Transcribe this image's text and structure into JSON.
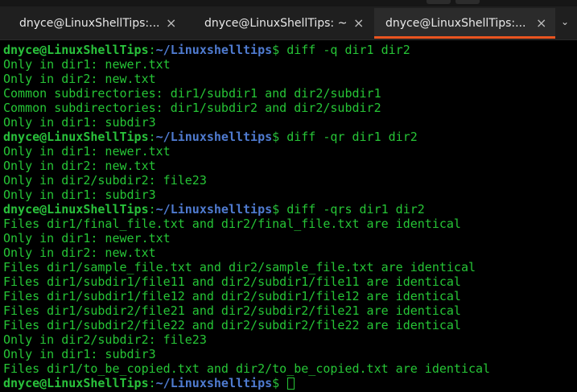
{
  "tabs": [
    {
      "label": "dnyce@LinuxShellTips:...",
      "close": "×"
    },
    {
      "label": "dnyce@LinuxShellTips: ~",
      "close": "×"
    },
    {
      "label": "dnyce@LinuxShellTips:...",
      "close": "×"
    }
  ],
  "tabbar_menu_icon": "chevron-down-icon",
  "colors": {
    "accent_underline": "#e95420",
    "output_green": "#26c536",
    "prompt_path_blue": "#4f7bd0"
  },
  "prompt": {
    "user": "dnyce@LinuxShellTips",
    "sep": ":",
    "path": "~/Linuxshelltips",
    "sym": "$"
  },
  "terminal": {
    "cmd1": " diff -q dir1 dir2",
    "out1": [
      "Only in dir1: newer.txt",
      "Only in dir2: new.txt",
      "Common subdirectories: dir1/subdir1 and dir2/subdir1",
      "Common subdirectories: dir1/subdir2 and dir2/subdir2",
      "Only in dir1: subdir3"
    ],
    "cmd2": " diff -qr dir1 dir2",
    "out2": [
      "Only in dir1: newer.txt",
      "Only in dir2: new.txt",
      "Only in dir2/subdir2: file23",
      "Only in dir1: subdir3"
    ],
    "cmd3": " diff -qrs dir1 dir2",
    "out3": [
      "Files dir1/final_file.txt and dir2/final_file.txt are identical",
      "Only in dir1: newer.txt",
      "Only in dir2: new.txt",
      "Files dir1/sample_file.txt and dir2/sample_file.txt are identical",
      "Files dir1/subdir1/file11 and dir2/subdir1/file11 are identical",
      "Files dir1/subdir1/file12 and dir2/subdir1/file12 are identical",
      "Files dir1/subdir2/file21 and dir2/subdir2/file21 are identical",
      "Files dir1/subdir2/file22 and dir2/subdir2/file22 are identical",
      "Only in dir2/subdir2: file23",
      "Only in dir1: subdir3",
      "Files dir1/to_be_copied.txt and dir2/to_be_copied.txt are identical"
    ]
  }
}
